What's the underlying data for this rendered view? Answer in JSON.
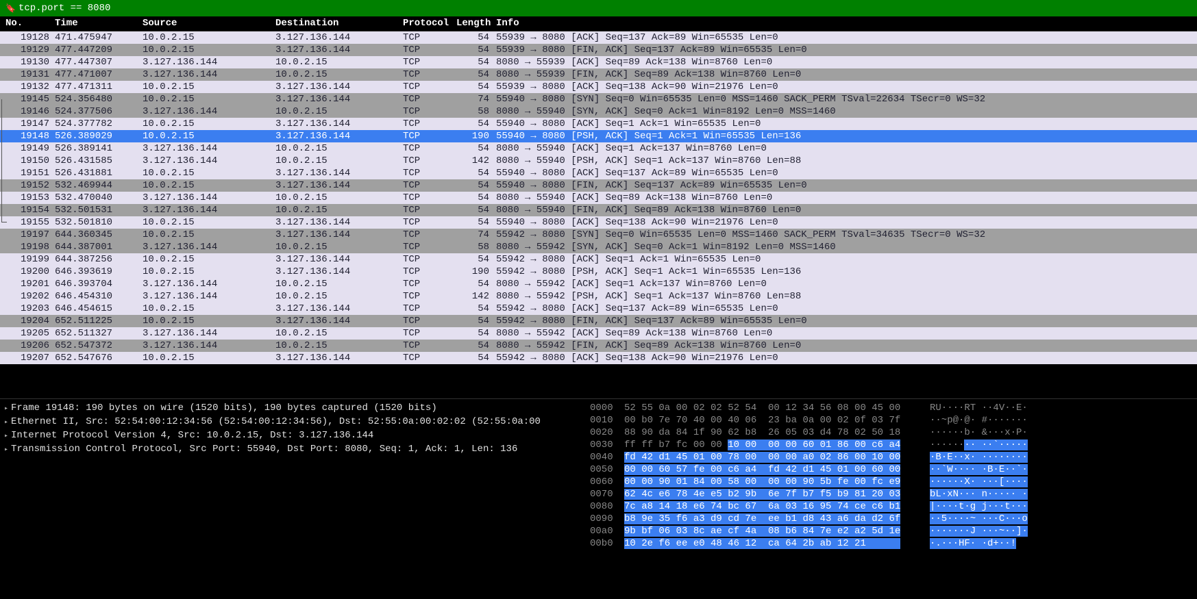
{
  "filter": "tcp.port == 8080",
  "columns": [
    "No.",
    "Time",
    "Source",
    "Destination",
    "Protocol",
    "Length",
    "Info"
  ],
  "selected_index": 7,
  "packets": [
    {
      "no": "19128",
      "time": "471.475947",
      "src": "10.0.2.15",
      "dst": "3.127.136.144",
      "proto": "TCP",
      "len": "54",
      "info": "55939 → 8080 [ACK] Seq=137 Ack=89 Win=65535 Len=0",
      "bg": "light"
    },
    {
      "no": "19129",
      "time": "477.447209",
      "src": "10.0.2.15",
      "dst": "3.127.136.144",
      "proto": "TCP",
      "len": "54",
      "info": "55939 → 8080 [FIN, ACK] Seq=137 Ack=89 Win=65535 Len=0",
      "bg": "gray"
    },
    {
      "no": "19130",
      "time": "477.447307",
      "src": "3.127.136.144",
      "dst": "10.0.2.15",
      "proto": "TCP",
      "len": "54",
      "info": "8080 → 55939 [ACK] Seq=89 Ack=138 Win=8760 Len=0",
      "bg": "light"
    },
    {
      "no": "19131",
      "time": "477.471007",
      "src": "3.127.136.144",
      "dst": "10.0.2.15",
      "proto": "TCP",
      "len": "54",
      "info": "8080 → 55939 [FIN, ACK] Seq=89 Ack=138 Win=8760 Len=0",
      "bg": "gray"
    },
    {
      "no": "19132",
      "time": "477.471311",
      "src": "10.0.2.15",
      "dst": "3.127.136.144",
      "proto": "TCP",
      "len": "54",
      "info": "55939 → 8080 [ACK] Seq=138 Ack=90 Win=21976 Len=0",
      "bg": "light"
    },
    {
      "no": "19145",
      "time": "524.356480",
      "src": "10.0.2.15",
      "dst": "3.127.136.144",
      "proto": "TCP",
      "len": "74",
      "info": "55940 → 8080 [SYN] Seq=0 Win=65535 Len=0 MSS=1460 SACK_PERM TSval=22634 TSecr=0 WS=32",
      "bg": "gray",
      "tree": "start"
    },
    {
      "no": "19146",
      "time": "524.377506",
      "src": "3.127.136.144",
      "dst": "10.0.2.15",
      "proto": "TCP",
      "len": "58",
      "info": "8080 → 55940 [SYN, ACK] Seq=0 Ack=1 Win=8192 Len=0 MSS=1460",
      "bg": "gray",
      "tree": "mid"
    },
    {
      "no": "19147",
      "time": "524.377782",
      "src": "10.0.2.15",
      "dst": "3.127.136.144",
      "proto": "TCP",
      "len": "54",
      "info": "55940 → 8080 [ACK] Seq=1 Ack=1 Win=65535 Len=0",
      "bg": "light",
      "tree": "mid"
    },
    {
      "no": "19148",
      "time": "526.389029",
      "src": "10.0.2.15",
      "dst": "3.127.136.144",
      "proto": "TCP",
      "len": "190",
      "info": "55940 → 8080 [PSH, ACK] Seq=1 Ack=1 Win=65535 Len=136",
      "bg": "selected",
      "tree": "mid"
    },
    {
      "no": "19149",
      "time": "526.389141",
      "src": "3.127.136.144",
      "dst": "10.0.2.15",
      "proto": "TCP",
      "len": "54",
      "info": "8080 → 55940 [ACK] Seq=1 Ack=137 Win=8760 Len=0",
      "bg": "light",
      "tree": "mid"
    },
    {
      "no": "19150",
      "time": "526.431585",
      "src": "3.127.136.144",
      "dst": "10.0.2.15",
      "proto": "TCP",
      "len": "142",
      "info": "8080 → 55940 [PSH, ACK] Seq=1 Ack=137 Win=8760 Len=88",
      "bg": "light",
      "tree": "mid"
    },
    {
      "no": "19151",
      "time": "526.431881",
      "src": "10.0.2.15",
      "dst": "3.127.136.144",
      "proto": "TCP",
      "len": "54",
      "info": "55940 → 8080 [ACK] Seq=137 Ack=89 Win=65535 Len=0",
      "bg": "light",
      "tree": "mid"
    },
    {
      "no": "19152",
      "time": "532.469944",
      "src": "10.0.2.15",
      "dst": "3.127.136.144",
      "proto": "TCP",
      "len": "54",
      "info": "55940 → 8080 [FIN, ACK] Seq=137 Ack=89 Win=65535 Len=0",
      "bg": "gray",
      "tree": "mid"
    },
    {
      "no": "19153",
      "time": "532.470040",
      "src": "3.127.136.144",
      "dst": "10.0.2.15",
      "proto": "TCP",
      "len": "54",
      "info": "8080 → 55940 [ACK] Seq=89 Ack=138 Win=8760 Len=0",
      "bg": "light",
      "tree": "mid"
    },
    {
      "no": "19154",
      "time": "532.501531",
      "src": "3.127.136.144",
      "dst": "10.0.2.15",
      "proto": "TCP",
      "len": "54",
      "info": "8080 → 55940 [FIN, ACK] Seq=89 Ack=138 Win=8760 Len=0",
      "bg": "gray",
      "tree": "mid"
    },
    {
      "no": "19155",
      "time": "532.501810",
      "src": "10.0.2.15",
      "dst": "3.127.136.144",
      "proto": "TCP",
      "len": "54",
      "info": "55940 → 8080 [ACK] Seq=138 Ack=90 Win=21976 Len=0",
      "bg": "light",
      "tree": "end"
    },
    {
      "no": "19197",
      "time": "644.360345",
      "src": "10.0.2.15",
      "dst": "3.127.136.144",
      "proto": "TCP",
      "len": "74",
      "info": "55942 → 8080 [SYN] Seq=0 Win=65535 Len=0 MSS=1460 SACK_PERM TSval=34635 TSecr=0 WS=32",
      "bg": "gray"
    },
    {
      "no": "19198",
      "time": "644.387001",
      "src": "3.127.136.144",
      "dst": "10.0.2.15",
      "proto": "TCP",
      "len": "58",
      "info": "8080 → 55942 [SYN, ACK] Seq=0 Ack=1 Win=8192 Len=0 MSS=1460",
      "bg": "gray"
    },
    {
      "no": "19199",
      "time": "644.387256",
      "src": "10.0.2.15",
      "dst": "3.127.136.144",
      "proto": "TCP",
      "len": "54",
      "info": "55942 → 8080 [ACK] Seq=1 Ack=1 Win=65535 Len=0",
      "bg": "light"
    },
    {
      "no": "19200",
      "time": "646.393619",
      "src": "10.0.2.15",
      "dst": "3.127.136.144",
      "proto": "TCP",
      "len": "190",
      "info": "55942 → 8080 [PSH, ACK] Seq=1 Ack=1 Win=65535 Len=136",
      "bg": "light"
    },
    {
      "no": "19201",
      "time": "646.393704",
      "src": "3.127.136.144",
      "dst": "10.0.2.15",
      "proto": "TCP",
      "len": "54",
      "info": "8080 → 55942 [ACK] Seq=1 Ack=137 Win=8760 Len=0",
      "bg": "light"
    },
    {
      "no": "19202",
      "time": "646.454310",
      "src": "3.127.136.144",
      "dst": "10.0.2.15",
      "proto": "TCP",
      "len": "142",
      "info": "8080 → 55942 [PSH, ACK] Seq=1 Ack=137 Win=8760 Len=88",
      "bg": "light"
    },
    {
      "no": "19203",
      "time": "646.454615",
      "src": "10.0.2.15",
      "dst": "3.127.136.144",
      "proto": "TCP",
      "len": "54",
      "info": "55942 → 8080 [ACK] Seq=137 Ack=89 Win=65535 Len=0",
      "bg": "light"
    },
    {
      "no": "19204",
      "time": "652.511225",
      "src": "10.0.2.15",
      "dst": "3.127.136.144",
      "proto": "TCP",
      "len": "54",
      "info": "55942 → 8080 [FIN, ACK] Seq=137 Ack=89 Win=65535 Len=0",
      "bg": "gray"
    },
    {
      "no": "19205",
      "time": "652.511327",
      "src": "3.127.136.144",
      "dst": "10.0.2.15",
      "proto": "TCP",
      "len": "54",
      "info": "8080 → 55942 [ACK] Seq=89 Ack=138 Win=8760 Len=0",
      "bg": "light"
    },
    {
      "no": "19206",
      "time": "652.547372",
      "src": "3.127.136.144",
      "dst": "10.0.2.15",
      "proto": "TCP",
      "len": "54",
      "info": "8080 → 55942 [FIN, ACK] Seq=89 Ack=138 Win=8760 Len=0",
      "bg": "gray"
    },
    {
      "no": "19207",
      "time": "652.547676",
      "src": "10.0.2.15",
      "dst": "3.127.136.144",
      "proto": "TCP",
      "len": "54",
      "info": "55942 → 8080 [ACK] Seq=138 Ack=90 Win=21976 Len=0",
      "bg": "light"
    }
  ],
  "details": [
    "Frame 19148: 190 bytes on wire (1520 bits), 190 bytes captured (1520 bits)",
    "Ethernet II, Src: 52:54:00:12:34:56 (52:54:00:12:34:56), Dst: 52:55:0a:00:02:02 (52:55:0a:00",
    "Internet Protocol Version 4, Src: 10.0.2.15, Dst: 3.127.136.144",
    "Transmission Control Protocol, Src Port: 55940, Dst Port: 8080, Seq: 1, Ack: 1, Len: 136"
  ],
  "hex": {
    "highlight_start_row": 3,
    "highlight_start_col": 6,
    "lines": [
      {
        "off": "0000",
        "b": "52 55 0a 00 02 02 52 54  00 12 34 56 08 00 45 00",
        "a": "RU····RT ··4V··E·"
      },
      {
        "off": "0010",
        "b": "00 b0 7e 70 40 00 40 06  23 ba 0a 00 02 0f 03 7f",
        "a": "··~p@·@· #·······"
      },
      {
        "off": "0020",
        "b": "88 90 da 84 1f 90 62 b8  26 05 03 d4 78 02 50 18",
        "a": "······b· &···x·P·"
      },
      {
        "off": "0030",
        "b": "ff ff b7 fc 00 00 10 00  00 00 60 01 86 00 c6 a4",
        "a": "········ ··`·····"
      },
      {
        "off": "0040",
        "b": "fd 42 d1 45 01 00 78 00  00 00 a0 02 86 00 10 00",
        "a": "·B·E··x· ········"
      },
      {
        "off": "0050",
        "b": "00 00 60 57 fe 00 c6 a4  fd 42 d1 45 01 00 60 00",
        "a": "··`W···· ·B·E··`·"
      },
      {
        "off": "0060",
        "b": "00 00 90 01 84 00 58 00  00 00 90 5b fe 00 fc e9",
        "a": "······X· ···[····"
      },
      {
        "off": "0070",
        "b": "62 4c e6 78 4e e5 b2 9b  6e 7f b7 f5 b9 81 20 03",
        "a": "bL·xN··· n····· ·"
      },
      {
        "off": "0080",
        "b": "7c a8 14 18 e6 74 bc 67  6a 03 16 95 74 ce c6 b1",
        "a": "|····t·g j···t···"
      },
      {
        "off": "0090",
        "b": "b8 9e 35 f6 a3 d9 cd 7e  ee b1 d8 43 a6 da d2 6f",
        "a": "··5····~ ···C···o"
      },
      {
        "off": "00a0",
        "b": "9b bf 06 03 8c ae cf 4a  08 b6 84 7e e2 a2 5d 1e",
        "a": "·······J ···~··]·"
      },
      {
        "off": "00b0",
        "b": "10 2e f6 ee e0 48 46 12  ca 64 2b ab 12 21      ",
        "a": "·.···HF· ·d+··!"
      }
    ]
  }
}
